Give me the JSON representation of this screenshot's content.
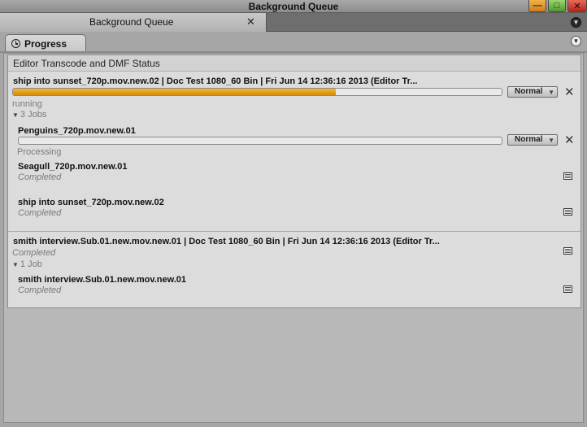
{
  "window": {
    "title": "Background Queue",
    "minimize_glyph": "—",
    "maximize_glyph": "□",
    "close_glyph": "✕"
  },
  "tab": {
    "label": "Background Queue",
    "close_glyph": "✕",
    "menu_glyph": "▼"
  },
  "panel": {
    "tab_label": "Progress",
    "menu_glyph": "▼",
    "status_header": "Editor Transcode and DMF Status"
  },
  "groups": [
    {
      "title": "ship into sunset_720p.mov.new.02 | Doc Test 1080_60 Bin | Fri Jun 14 12:36:16 2013 (Editor Tr...",
      "progress": 0.66,
      "priority": "Normal",
      "status": "running",
      "jobs_label": "3 Jobs",
      "jobs": [
        {
          "title": "Penguins_720p.mov.new.01",
          "status": "Processing",
          "progress": 0.0,
          "priority": "Normal"
        },
        {
          "title": "Seagull_720p.mov.new.01",
          "status": "Completed"
        },
        {
          "title": "ship into sunset_720p.mov.new.02",
          "status": "Completed"
        }
      ]
    },
    {
      "title": "smith interview.Sub.01.new.mov.new.01 | Doc Test 1080_60 Bin | Fri Jun 14 12:36:16 2013 (Editor Tr...",
      "status": "Completed",
      "jobs_label": "1 Job",
      "jobs": [
        {
          "title": "smith interview.Sub.01.new.mov.new.01",
          "status": "Completed"
        }
      ]
    }
  ],
  "icons": {
    "priority_caret": "▼",
    "remove": "✕",
    "expand": "▼"
  }
}
